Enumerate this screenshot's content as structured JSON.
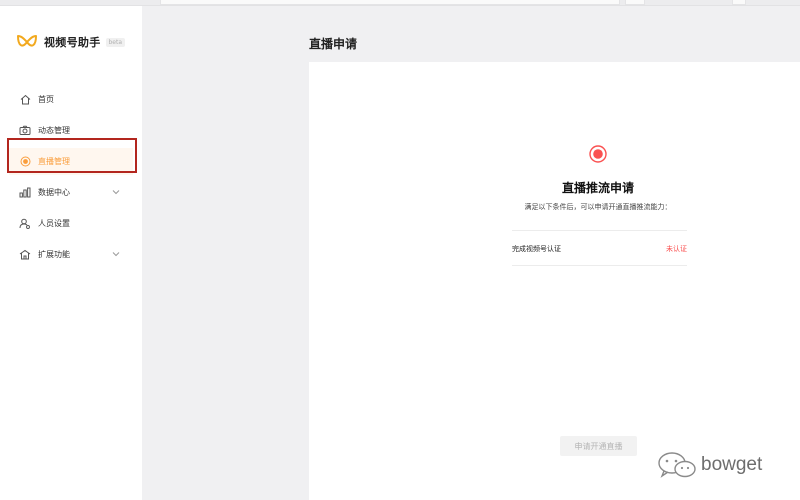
{
  "app": {
    "name": "视频号助手",
    "badge": "beta"
  },
  "sidebar": {
    "items": [
      {
        "label": "首页",
        "icon": "home-icon",
        "has_chevron": false,
        "active": false
      },
      {
        "label": "动态管理",
        "icon": "camera-icon",
        "has_chevron": false,
        "active": false
      },
      {
        "label": "直播管理",
        "icon": "live-record-icon",
        "has_chevron": false,
        "active": true
      },
      {
        "label": "数据中心",
        "icon": "bar-chart-icon",
        "has_chevron": true,
        "active": false
      },
      {
        "label": "人员设置",
        "icon": "user-settings-icon",
        "has_chevron": false,
        "active": false
      },
      {
        "label": "扩展功能",
        "icon": "extension-icon",
        "has_chevron": true,
        "active": false
      }
    ]
  },
  "main": {
    "title": "直播申请",
    "card": {
      "heading": "直播推流申请",
      "subtitle": "满足以下条件后，可以申请开通直播推流能力：",
      "requirement": {
        "label": "完成视频号认证",
        "status": "未认证"
      },
      "apply_button": "申请开通直播"
    }
  },
  "watermark": {
    "text": "bowget"
  },
  "colors": {
    "accent_orange": "#fa9d3b",
    "record_red": "#fa5151",
    "highlight_frame": "#b3261e"
  }
}
